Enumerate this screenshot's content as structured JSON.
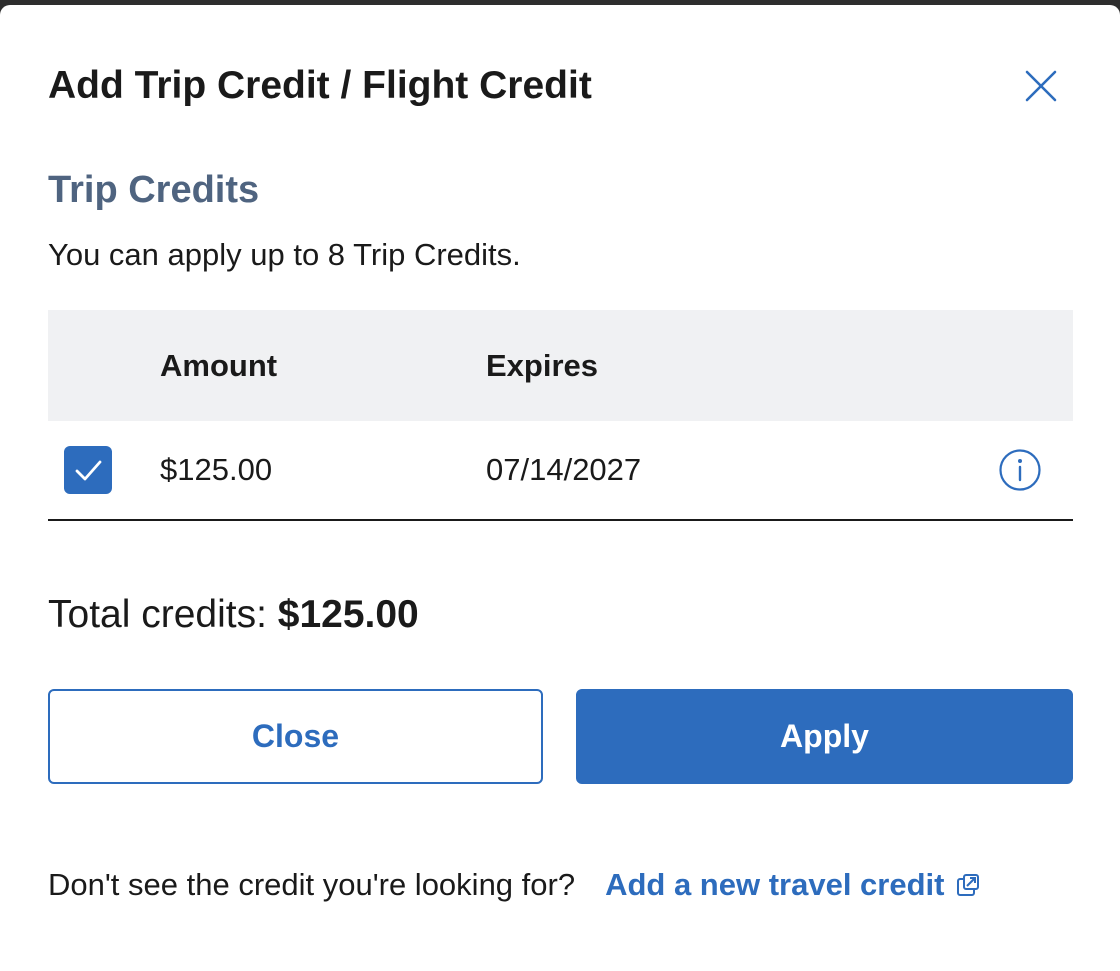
{
  "modal": {
    "title": "Add Trip Credit / Flight Credit",
    "close_icon": "close-icon"
  },
  "section": {
    "title": "Trip Credits",
    "description": "You can apply up to 8 Trip Credits."
  },
  "table": {
    "headers": {
      "amount": "Amount",
      "expires": "Expires"
    },
    "rows": [
      {
        "selected": true,
        "amount": "$125.00",
        "expires": "07/14/2027",
        "info_icon": "info-icon"
      }
    ]
  },
  "total": {
    "label": "Total credits: ",
    "value": "$125.00"
  },
  "buttons": {
    "close_label": "Close",
    "apply_label": "Apply"
  },
  "footer": {
    "text": "Don't see the credit you're looking for?",
    "link_label": "Add a new travel credit",
    "link_icon": "external-link-icon"
  },
  "colors": {
    "accent": "#2d6cbd",
    "section_title": "#4f6480",
    "table_header_bg": "#f0f1f3",
    "text": "#1a1a1a"
  }
}
